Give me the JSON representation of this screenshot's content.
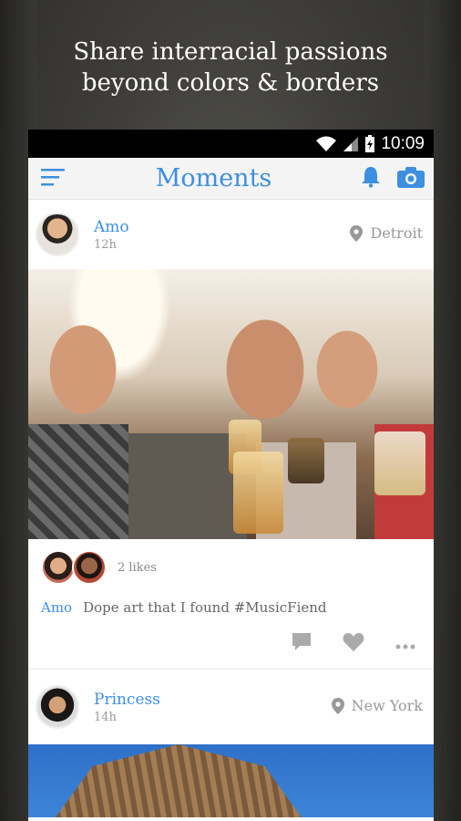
{
  "tagline": {
    "line1": "Share interracial passions",
    "line2": "beyond colors & borders"
  },
  "status_bar": {
    "time": "10:09",
    "icons": [
      "wifi-icon",
      "signal-icon",
      "battery-icon"
    ]
  },
  "app_bar": {
    "title": "Moments",
    "icons": [
      "menu-icon",
      "bell-icon",
      "camera-icon"
    ]
  },
  "posts": [
    {
      "user": "Amo",
      "time": "12h",
      "location": "Detroit",
      "likes": "2 likes",
      "caption_user": "Amo",
      "caption": "Dope art that I found #MusicFiend"
    },
    {
      "user": "Princess",
      "time": "14h",
      "location": "New York"
    }
  ],
  "colors": {
    "accent": "#3d8fe0",
    "muted": "#999999"
  }
}
